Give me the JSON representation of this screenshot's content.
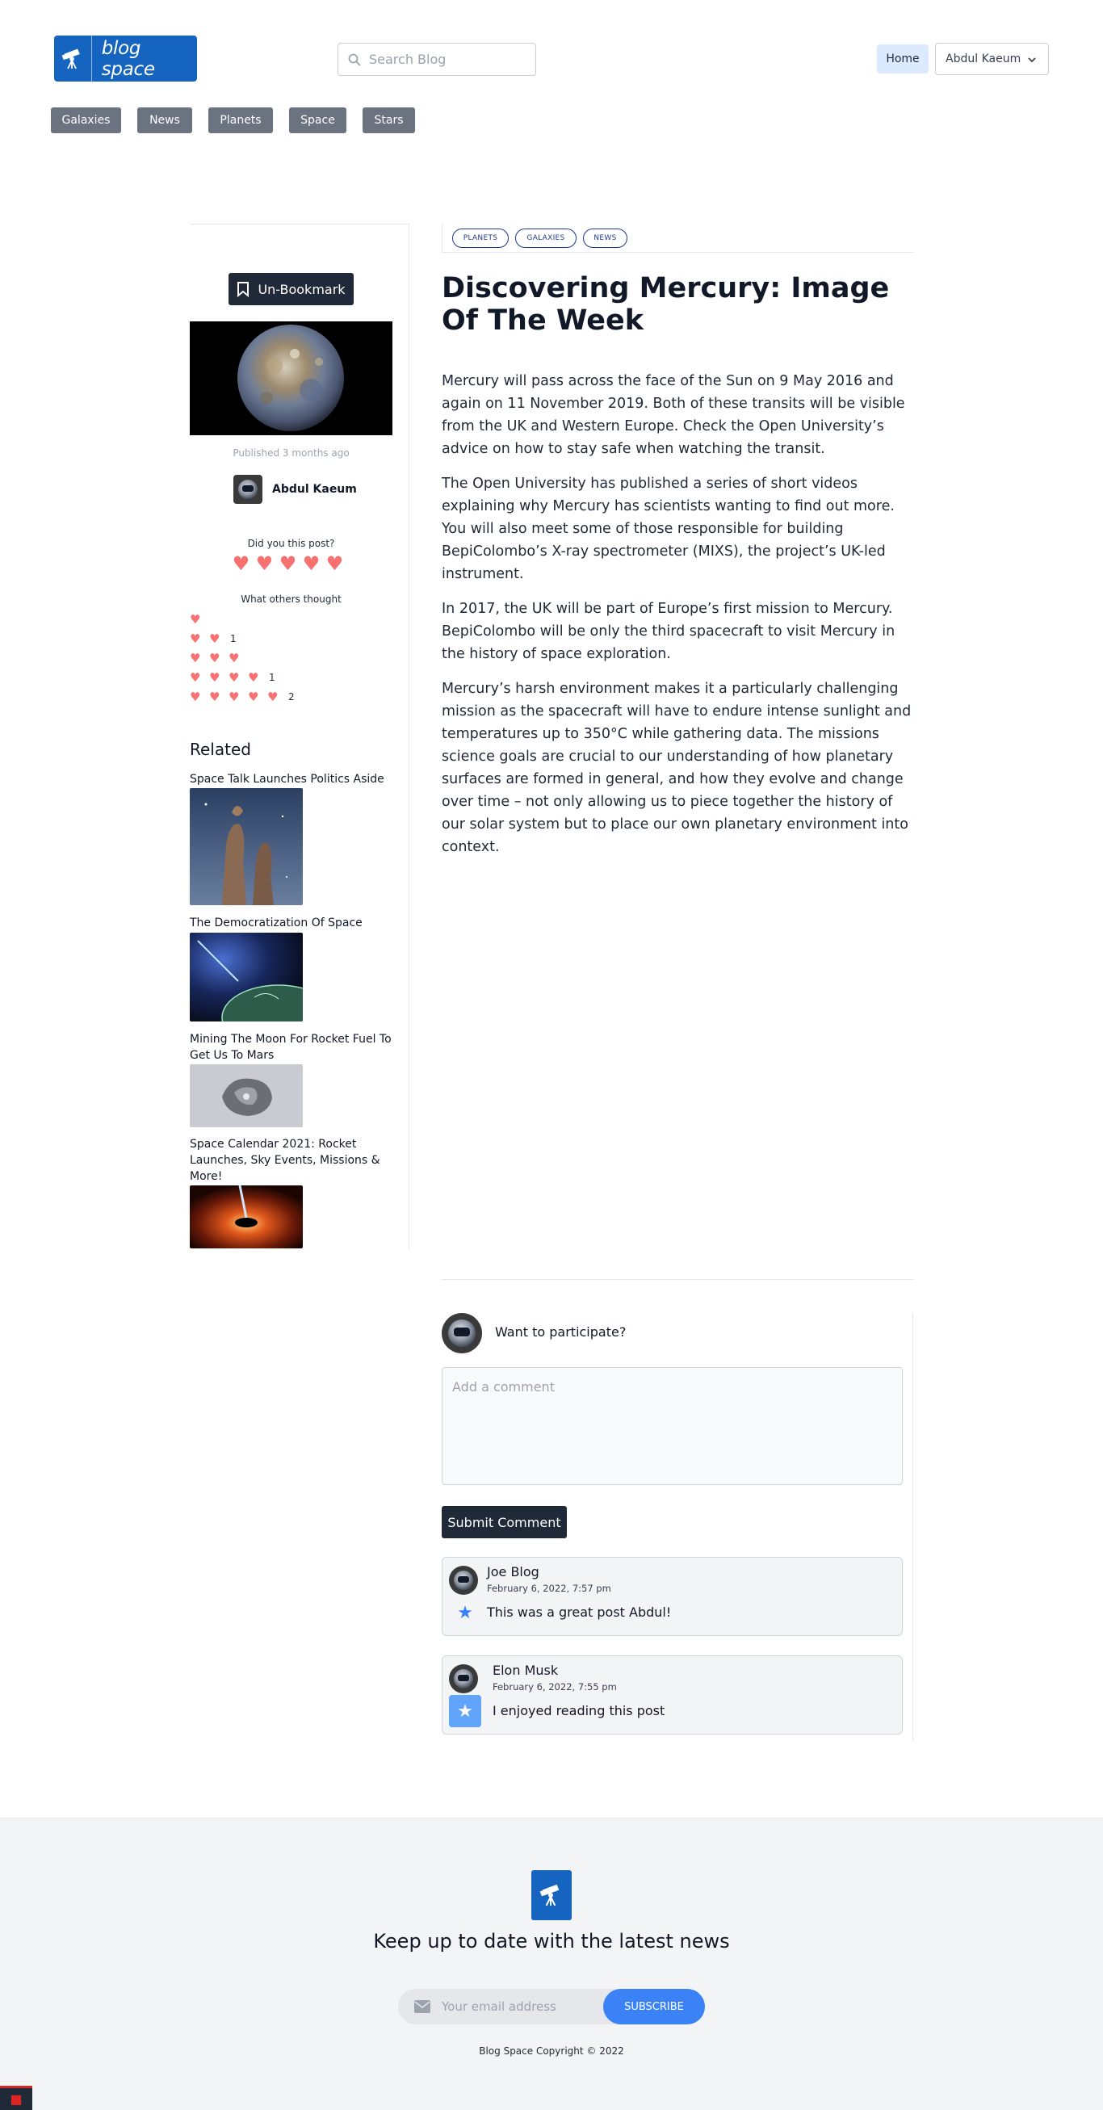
{
  "header": {
    "brand": "blog space",
    "search_placeholder": "Search Blog",
    "home_label": "Home",
    "user_label": "Abdul Kaeum"
  },
  "categories": [
    "Galaxies",
    "News",
    "Planets",
    "Space",
    "Stars"
  ],
  "sidebar": {
    "bookmark_label": "Un-Bookmark",
    "published": "Published 3 months ago",
    "author": "Abdul Kaeum",
    "rate_prompt": "Did you this post?",
    "others_label": "What others thought",
    "rating_counts": [
      "",
      "1",
      "",
      "1",
      "2"
    ],
    "related_heading": "Related",
    "related": [
      "Space Talk Launches Politics Aside",
      "The Democratization Of Space",
      "Mining The Moon For Rocket Fuel To Get Us To Mars",
      "Space Calendar 2021: Rocket Launches, Sky Events, Missions & More!"
    ]
  },
  "article": {
    "tags": [
      "PLANETS",
      "GALAXIES",
      "NEWS"
    ],
    "title": "Discovering Mercury: Image Of The Week",
    "paragraphs": [
      "Mercury will pass across the face of the Sun on 9 May 2016 and again on 11 November 2019. Both of these transits will be visible from the UK and Western Europe. Check the Open University’s advice on how to stay safe when watching the transit.",
      "The Open University has published a series of short videos explaining why Mercury has scientists wanting to find out more. You will also meet some of those responsible for building BepiColombo’s X-ray spectrometer (MIXS), the project’s UK-led instrument.",
      "In 2017, the UK will be part of Europe’s first mission to Mercury. BepiColombo will be only the third spacecraft to visit Mercury in the history of space exploration.",
      "Mercury’s harsh environment makes it a particularly challenging mission as the spacecraft will have to endure intense sunlight and temperatures up to 350°C while gathering data. The missions science goals are crucial to our understanding of how planetary surfaces are formed in general, and how they evolve and change over time – not only allowing us to piece together the history of our solar system but to place our own planetary environment into context."
    ]
  },
  "comments": {
    "prompt": "Want to participate?",
    "placeholder": "Add a comment",
    "submit_label": "Submit Comment",
    "items": [
      {
        "name": "Joe Blog",
        "date": "February 6, 2022, 7:57 pm",
        "text": "This was a great post Abdul!"
      },
      {
        "name": "Elon Musk",
        "date": "February 6, 2022, 7:55 pm",
        "text": "I enjoyed reading this post"
      }
    ]
  },
  "footer": {
    "heading": "Keep up to date with the latest news",
    "email_placeholder": "Your email address",
    "subscribe_label": "SUBSCRIBE",
    "copyright": "Blog Space Copyright © 2022"
  },
  "colors": {
    "brand": "#1565c0",
    "dark_button": "#1f2937",
    "heart": "#f87171",
    "subscribe": "#3b82f6"
  }
}
